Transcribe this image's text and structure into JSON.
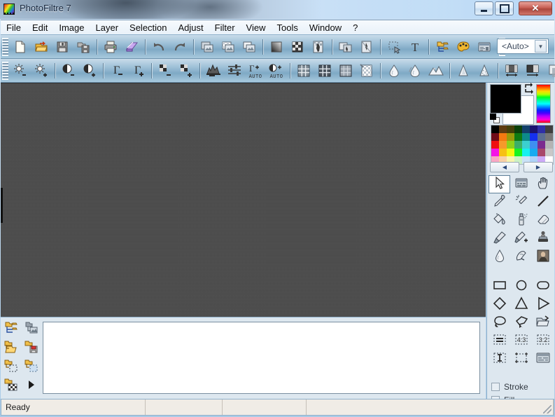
{
  "window": {
    "title": "PhotoFiltre 7",
    "app_icon": "photofiltre-logo-icon",
    "minimize_label": "",
    "maximize_label": "",
    "close_label": "✕"
  },
  "menubar": {
    "items": [
      {
        "label": "File",
        "name": "menu-file"
      },
      {
        "label": "Edit",
        "name": "menu-edit"
      },
      {
        "label": "Image",
        "name": "menu-image"
      },
      {
        "label": "Layer",
        "name": "menu-layer"
      },
      {
        "label": "Selection",
        "name": "menu-selection"
      },
      {
        "label": "Adjust",
        "name": "menu-adjust"
      },
      {
        "label": "Filter",
        "name": "menu-filter"
      },
      {
        "label": "View",
        "name": "menu-view"
      },
      {
        "label": "Tools",
        "name": "menu-tools"
      },
      {
        "label": "Window",
        "name": "menu-window"
      },
      {
        "label": "?",
        "name": "menu-help"
      }
    ]
  },
  "toolbar_main": {
    "buttons": [
      {
        "name": "new-file-icon",
        "tooltip": "New"
      },
      {
        "name": "open-file-icon",
        "tooltip": "Open"
      },
      {
        "name": "save-icon",
        "tooltip": "Save"
      },
      {
        "name": "save-as-icon",
        "tooltip": "Save As"
      },
      {
        "name": "print-icon",
        "tooltip": "Print"
      },
      {
        "name": "scanner-icon",
        "tooltip": "Acquire"
      },
      {
        "name": "undo-icon",
        "tooltip": "Undo"
      },
      {
        "name": "redo-icon",
        "tooltip": "Redo"
      },
      {
        "name": "copy-image-icon",
        "tooltip": "Copy"
      },
      {
        "name": "paste-transparent-icon",
        "tooltip": "Paste"
      },
      {
        "name": "duplicate-image-icon",
        "tooltip": "Duplicate"
      },
      {
        "name": "gradient-icon",
        "tooltip": "Gradient"
      },
      {
        "name": "pattern-icon",
        "tooltip": "Pattern"
      },
      {
        "name": "image-mask-icon",
        "tooltip": "Mask"
      },
      {
        "name": "flip-horizontal-icon",
        "tooltip": "Flip Horizontal"
      },
      {
        "name": "flip-vertical-icon",
        "tooltip": "Flip Vertical"
      },
      {
        "name": "selection-move-icon",
        "tooltip": "Selection"
      },
      {
        "name": "text-tool-icon",
        "tooltip": "Text"
      },
      {
        "name": "layers-manager-icon",
        "tooltip": "Layers"
      },
      {
        "name": "color-palette-icon",
        "tooltip": "Palette"
      },
      {
        "name": "preferences-icon",
        "tooltip": "Preferences"
      }
    ],
    "zoom_combo": {
      "name": "zoom-combo",
      "value": "<Auto>",
      "arrow": "▼"
    }
  },
  "toolbar_adjust": {
    "buttons": [
      {
        "name": "brightness-decrease-icon",
        "tooltip": "Brightness -"
      },
      {
        "name": "brightness-increase-icon",
        "tooltip": "Brightness +"
      },
      {
        "name": "contrast-decrease-icon",
        "tooltip": "Contrast -"
      },
      {
        "name": "contrast-increase-icon",
        "tooltip": "Contrast +"
      },
      {
        "name": "gamma-decrease-icon",
        "tooltip": "Gamma -"
      },
      {
        "name": "gamma-increase-icon",
        "tooltip": "Gamma +"
      },
      {
        "name": "saturation-decrease-icon",
        "tooltip": "Saturation -"
      },
      {
        "name": "saturation-increase-icon",
        "tooltip": "Saturation +"
      },
      {
        "name": "histogram-icon",
        "tooltip": "Histogram"
      },
      {
        "name": "levels-icon",
        "tooltip": "Levels"
      },
      {
        "name": "auto-gamma-icon",
        "tooltip": "Auto Gamma",
        "caption": "AUTO"
      },
      {
        "name": "auto-contrast-icon",
        "tooltip": "Auto Contrast",
        "caption": "AUTO"
      },
      {
        "name": "grayscale-icon",
        "tooltip": "Grayscale"
      },
      {
        "name": "posterize-icon",
        "tooltip": "Posterize"
      },
      {
        "name": "dither-icon",
        "tooltip": "Dither"
      },
      {
        "name": "transparency-icon",
        "tooltip": "Transparency"
      },
      {
        "name": "blur-icon",
        "tooltip": "Blur"
      },
      {
        "name": "blur-more-icon",
        "tooltip": "Blur More"
      },
      {
        "name": "sharpen-icon",
        "tooltip": "Sharpen"
      },
      {
        "name": "soften-icon",
        "tooltip": "Soften"
      },
      {
        "name": "noise-icon",
        "tooltip": "Noise"
      },
      {
        "name": "resize-width-icon",
        "tooltip": "Image Size"
      },
      {
        "name": "resize-canvas-icon",
        "tooltip": "Canvas Size"
      },
      {
        "name": "shadow-icon",
        "tooltip": "Drop Shadow"
      }
    ]
  },
  "layer_tools": {
    "buttons": [
      {
        "name": "new-layer-icon",
        "tooltip": "New Layer"
      },
      {
        "name": "layer-from-image-icon",
        "tooltip": "Layer from Image"
      },
      {
        "name": "open-layer-icon",
        "tooltip": "Open Layer"
      },
      {
        "name": "save-layer-icon",
        "tooltip": "Save Layer"
      },
      {
        "name": "layer-selection-icon",
        "tooltip": "Layer Selection"
      },
      {
        "name": "layer-mask-icon",
        "tooltip": "Layer Mask"
      },
      {
        "name": "layer-transparency-icon",
        "tooltip": "Layer Transparency"
      },
      {
        "name": "layer-expand-icon",
        "tooltip": "More"
      }
    ]
  },
  "right_dock": {
    "colors": {
      "foreground": "#000000",
      "background": "#ffffff",
      "swap_icon": "swap-colors-icon",
      "hue_strip": "hue-gradient-strip"
    },
    "palette_rows": [
      [
        "#000000",
        "#5e3b10",
        "#45400a",
        "#0b4009",
        "#12406b",
        "#1b1270",
        "#2f2fa8",
        "#3f3f3f"
      ],
      [
        "#6e0a18",
        "#f47a10",
        "#9a9a0b",
        "#0f7a12",
        "#0d8a8a",
        "#1530ef",
        "#5c6e94",
        "#787878"
      ],
      [
        "#ef1010",
        "#f79a2a",
        "#8fd11a",
        "#3cae69",
        "#3bd0cf",
        "#3f8ff0",
        "#7b2a8f",
        "#b4b4b4"
      ],
      [
        "#f514e6",
        "#f7c013",
        "#f2f613",
        "#17f221",
        "#16f0ef",
        "#16aaf0",
        "#a8476b",
        "#c8c8c8"
      ],
      [
        "#f9a8c4",
        "#f9d0a6",
        "#f7f5b0",
        "#ccf2c4",
        "#c9e2f7",
        "#aed2f7",
        "#cdaaf7",
        "#ffffff"
      ]
    ],
    "palette_prev": "◀",
    "palette_next": "▶",
    "tools_primary": [
      {
        "name": "pointer-tool-icon",
        "tooltip": "Selection Pointer",
        "selected": true
      },
      {
        "name": "screenshot-tool-icon",
        "tooltip": "Capture"
      },
      {
        "name": "hand-tool-icon",
        "tooltip": "Hand"
      },
      {
        "name": "eyedropper-tool-icon",
        "tooltip": "Color Picker"
      },
      {
        "name": "magic-wand-tool-icon",
        "tooltip": "Magic Wand"
      },
      {
        "name": "line-tool-icon",
        "tooltip": "Line"
      },
      {
        "name": "paint-bucket-tool-icon",
        "tooltip": "Fill"
      },
      {
        "name": "airbrush-tool-icon",
        "tooltip": "Airbrush"
      },
      {
        "name": "eraser-tool-icon",
        "tooltip": "Eraser"
      },
      {
        "name": "paintbrush-tool-icon",
        "tooltip": "Paintbrush"
      },
      {
        "name": "advanced-brush-tool-icon",
        "tooltip": "Advanced Brush"
      },
      {
        "name": "clone-stamp-tool-icon",
        "tooltip": "Clone Stamp"
      },
      {
        "name": "blur-tool-icon",
        "tooltip": "Blur Tool"
      },
      {
        "name": "smudge-tool-icon",
        "tooltip": "Smudge"
      },
      {
        "name": "image-thumbnail-tool-icon",
        "tooltip": "Picture Tube"
      }
    ],
    "tools_shapes": [
      {
        "name": "rectangle-shape-icon",
        "tooltip": "Rectangle"
      },
      {
        "name": "ellipse-shape-icon",
        "tooltip": "Ellipse"
      },
      {
        "name": "rounded-rectangle-shape-icon",
        "tooltip": "Rounded Rectangle"
      },
      {
        "name": "diamond-shape-icon",
        "tooltip": "Diamond"
      },
      {
        "name": "triangle-shape-icon",
        "tooltip": "Triangle"
      },
      {
        "name": "arrow-shape-icon",
        "tooltip": "Arrow"
      },
      {
        "name": "lasso-shape-icon",
        "tooltip": "Lasso"
      },
      {
        "name": "polygon-shape-icon",
        "tooltip": "Polygon"
      },
      {
        "name": "load-shape-icon",
        "tooltip": "Load Shape"
      },
      {
        "name": "fixed-size-icon",
        "tooltip": "Fixed Size"
      },
      {
        "name": "ratio-4-3-icon",
        "tooltip": "Ratio 4:3",
        "caption": "4:3"
      },
      {
        "name": "ratio-3-2-icon",
        "tooltip": "Ratio 3:2",
        "caption": "3:2"
      },
      {
        "name": "vertical-marquee-icon",
        "tooltip": "Vertical Selection"
      },
      {
        "name": "transform-selection-icon",
        "tooltip": "Transform"
      },
      {
        "name": "selection-options-icon",
        "tooltip": "Selection Options"
      }
    ],
    "options": [
      {
        "name": "stroke-checkbox",
        "label": "Stroke",
        "checked": false
      },
      {
        "name": "fill-checkbox",
        "label": "Fill",
        "checked": false
      }
    ]
  },
  "statusbar": {
    "cells": [
      "Ready",
      "",
      "",
      ""
    ]
  }
}
